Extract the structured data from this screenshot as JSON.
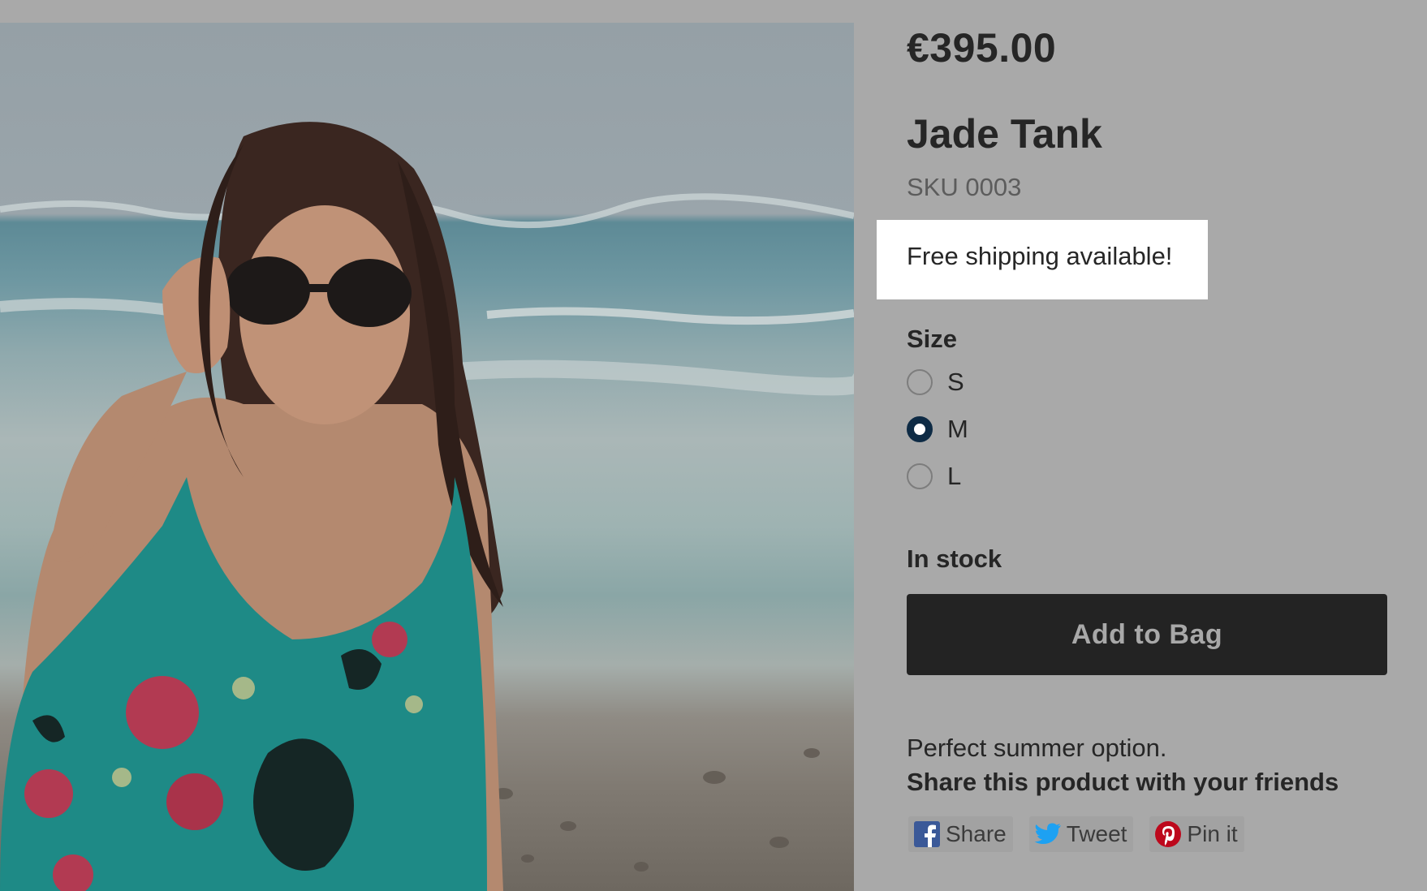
{
  "product": {
    "price": "€395.00",
    "title": "Jade Tank",
    "sku": "SKU 0003",
    "shipping_notice": "Free shipping available!",
    "description": "Perfect summer option."
  },
  "size": {
    "label": "Size",
    "options": [
      {
        "label": "S",
        "selected": false
      },
      {
        "label": "M",
        "selected": true
      },
      {
        "label": "L",
        "selected": false
      }
    ]
  },
  "stock": {
    "status": "In stock"
  },
  "cart": {
    "add_label": "Add to Bag"
  },
  "share": {
    "heading": "Share this product with your friends",
    "buttons": [
      {
        "label": "Share",
        "icon": "facebook-icon",
        "color": "#3b5998"
      },
      {
        "label": "Tweet",
        "icon": "twitter-icon",
        "color": "#1da1f2"
      },
      {
        "label": "Pin it",
        "icon": "pinterest-icon",
        "color": "#bd081c"
      }
    ]
  },
  "colors": {
    "overlay_background": "#a9a9a9",
    "button_background": "#232323",
    "radio_selected": "#0e2b45"
  }
}
